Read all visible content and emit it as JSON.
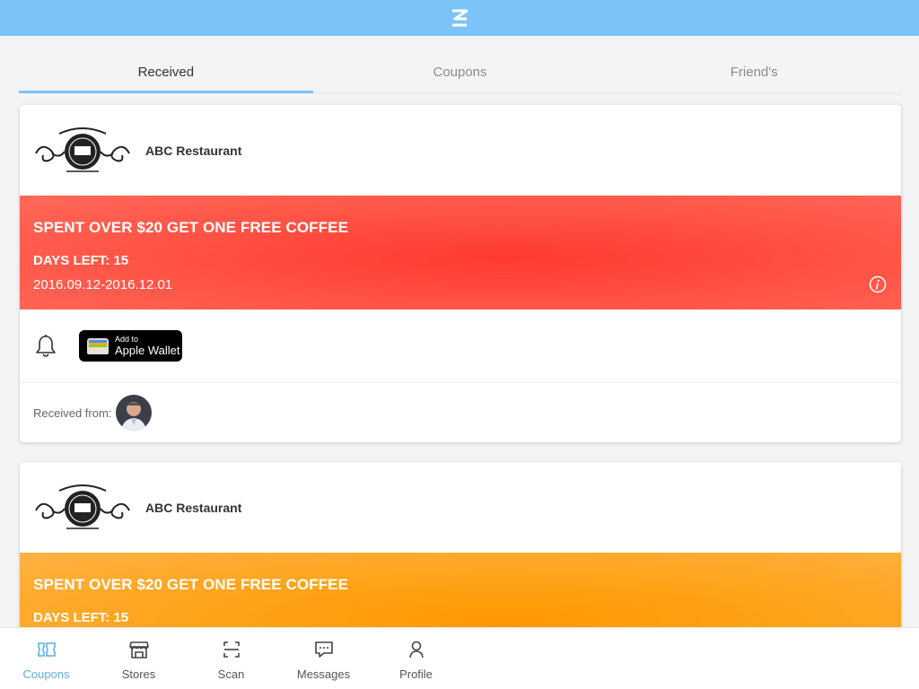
{
  "app": {
    "logo_icon": "z-logo-icon"
  },
  "colors": {
    "accent": "#7cc4f7",
    "red_banner": "#ff3a30",
    "orange_banner": "#ff9800",
    "nav_active": "#5aaef0"
  },
  "tabs": [
    {
      "label": "Received",
      "active": true
    },
    {
      "label": "Coupons",
      "active": false
    },
    {
      "label": "Friend's",
      "active": false
    }
  ],
  "cards": [
    {
      "store_name": "ABC Restaurant",
      "offer": "SPENT OVER $20 GET ONE FREE COFFEE",
      "days_left": "DAYS LEFT: 15",
      "date_range": "2016.09.12-2016.12.01",
      "wallet_small": "Add to",
      "wallet_big": "Apple Wallet",
      "received_from": "Received from:"
    },
    {
      "store_name": "ABC Restaurant",
      "offer": "SPENT OVER $20 GET ONE FREE COFFEE",
      "days_left": "DAYS LEFT: 15"
    }
  ],
  "bottom_nav": [
    {
      "label": "Coupons",
      "icon": "coupon-icon",
      "active": true
    },
    {
      "label": "Stores",
      "icon": "store-icon",
      "active": false
    },
    {
      "label": "Scan",
      "icon": "scan-icon",
      "active": false
    },
    {
      "label": "Messages",
      "icon": "message-icon",
      "active": false
    },
    {
      "label": "Profile",
      "icon": "profile-icon",
      "active": false
    }
  ]
}
